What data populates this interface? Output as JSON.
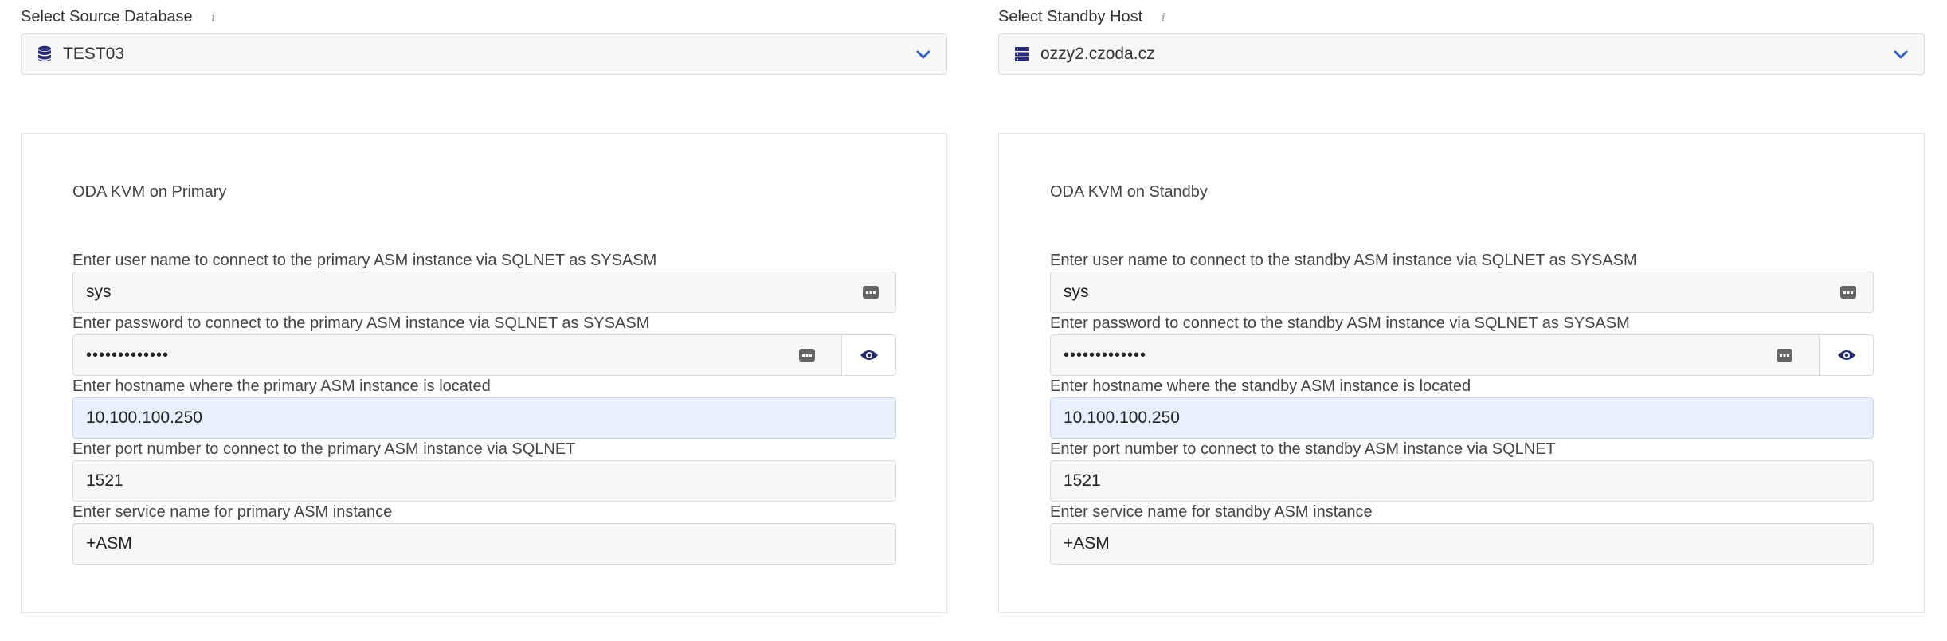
{
  "left": {
    "select_label": "Select Source Database",
    "select_value": "TEST03",
    "select_icon": "database-icon",
    "panel_title": "ODA KVM on Primary",
    "fields": {
      "user": {
        "label": "Enter user name to connect to the primary ASM instance via SQLNET as SYSASM",
        "value": "sys"
      },
      "password": {
        "label": "Enter password to connect to the primary ASM instance via SQLNET as SYSASM",
        "value": "•••••••••••••"
      },
      "hostname": {
        "label": "Enter hostname where the primary ASM instance is located",
        "value": "10.100.100.250"
      },
      "port": {
        "label": "Enter port number to connect to the primary ASM instance via SQLNET",
        "value": "1521"
      },
      "service": {
        "label": "Enter service name for primary ASM instance",
        "value": "+ASM"
      }
    }
  },
  "right": {
    "select_label": "Select Standby Host",
    "select_value": "ozzy2.czoda.cz",
    "select_icon": "server-icon",
    "panel_title": "ODA KVM on Standby",
    "fields": {
      "user": {
        "label": "Enter user name to connect to the standby ASM instance via SQLNET as SYSASM",
        "value": "sys"
      },
      "password": {
        "label": "Enter password to connect to the standby ASM instance via SQLNET as SYSASM",
        "value": "•••••••••••••"
      },
      "hostname": {
        "label": "Enter hostname where the standby ASM instance is located",
        "value": "10.100.100.250"
      },
      "port": {
        "label": "Enter port number to connect to the standby ASM instance via SQLNET",
        "value": "1521"
      },
      "service": {
        "label": "Enter service name for standby ASM instance",
        "value": "+ASM"
      }
    }
  },
  "colors": {
    "accent_blue": "#2f5fd0",
    "icon_navy": "#2b2d7a",
    "highlight_field": "#e8f0fe"
  }
}
